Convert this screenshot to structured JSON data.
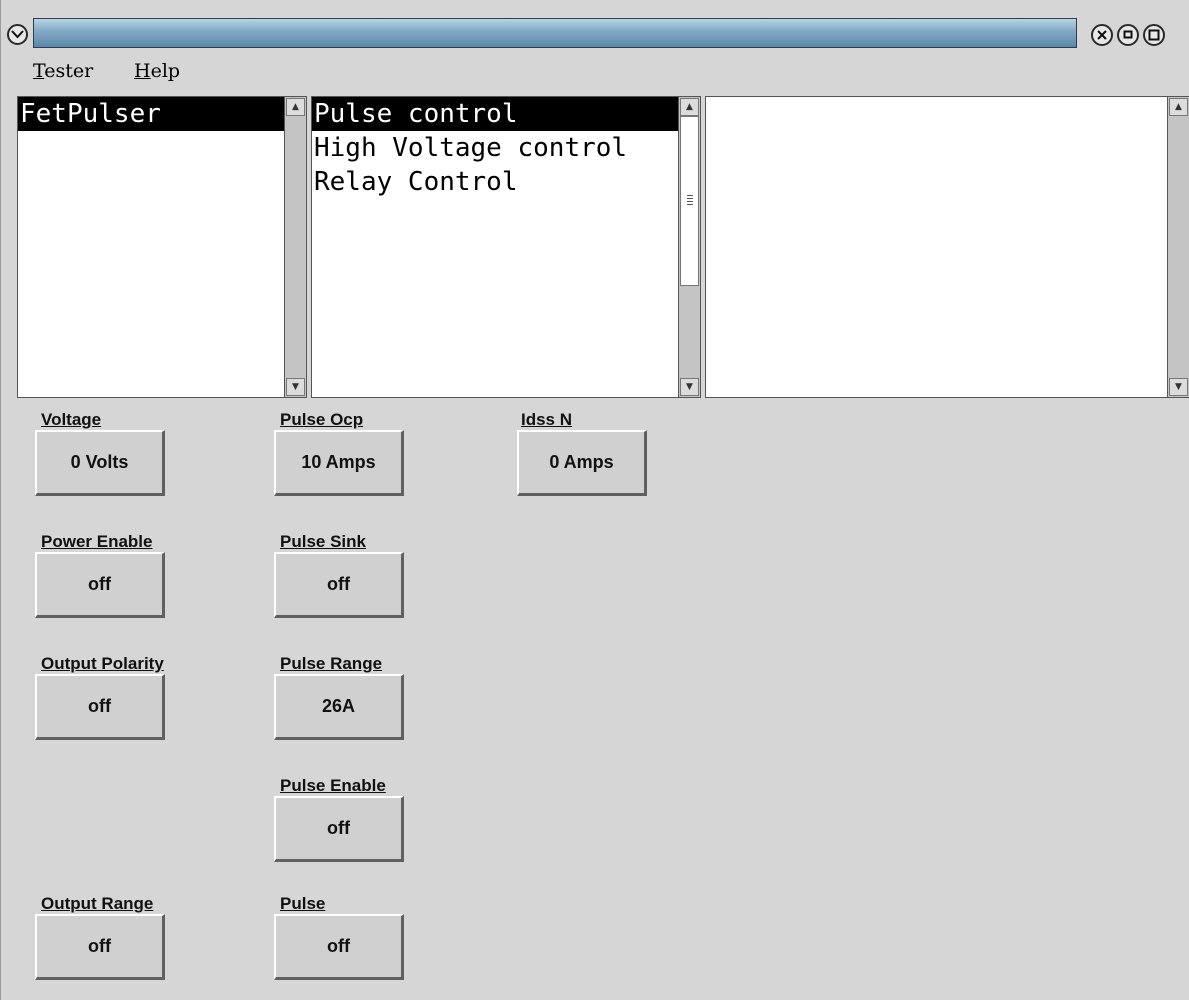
{
  "menu": {
    "tester": {
      "mnemonic": "T",
      "rest": "ester"
    },
    "help": {
      "mnemonic": "H",
      "rest": "elp"
    }
  },
  "lists": {
    "devices": {
      "items": [
        "FetPulser"
      ],
      "selected": 0
    },
    "functions": {
      "items": [
        "Pulse control",
        "High Voltage control",
        "Relay Control"
      ],
      "selected": 0
    },
    "details": {
      "items": []
    }
  },
  "controls": {
    "voltage": {
      "label": "Voltage",
      "value": "0 Volts"
    },
    "pulse_ocp": {
      "label": "Pulse Ocp",
      "value": "10 Amps"
    },
    "idss_n": {
      "label": "Idss N",
      "value": "0 Amps"
    },
    "power_enable": {
      "label": "Power Enable",
      "value": "off"
    },
    "pulse_sink": {
      "label": "Pulse Sink",
      "value": "off"
    },
    "output_polarity": {
      "label": "Output Polarity",
      "value": "off"
    },
    "pulse_range": {
      "label": "Pulse Range",
      "value": "26A"
    },
    "pulse_enable": {
      "label": "Pulse Enable",
      "value": "off"
    },
    "output_range": {
      "label": "Output Range",
      "value": "off"
    },
    "pulse": {
      "label": "Pulse",
      "value": "off"
    }
  },
  "colors": {
    "title_bar": "#7fa8c4",
    "selection": "#000000",
    "button_face": "#d0d0d0"
  },
  "icons": {
    "window_menu": "chevron-down-icon",
    "close": "close-icon",
    "minimize": "minimize-icon",
    "maximize": "maximize-icon"
  }
}
